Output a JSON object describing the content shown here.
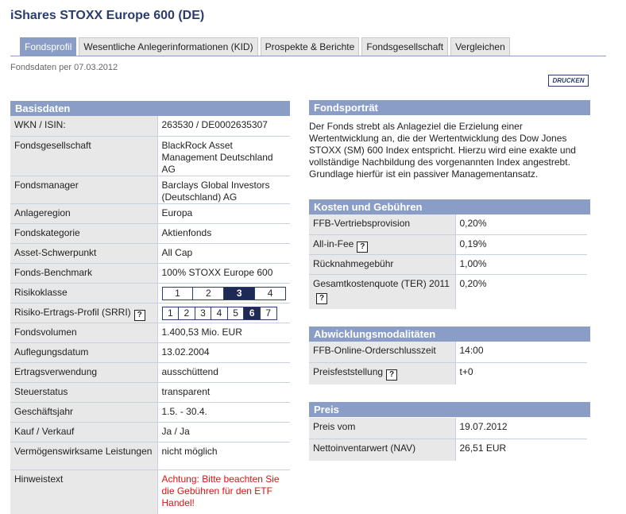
{
  "page": {
    "title": "iShares STOXX Europe 600 (DE)",
    "as_of": "Fondsdaten per 07.03.2012",
    "print_label": "DRUCKEN"
  },
  "tabs": [
    {
      "label": "Fondsprofil",
      "active": true
    },
    {
      "label": "Wesentliche Anlegerinformationen (KID)",
      "active": false
    },
    {
      "label": "Prospekte & Berichte",
      "active": false
    },
    {
      "label": "Fondsgesellschaft",
      "active": false
    },
    {
      "label": "Vergleichen",
      "active": false
    }
  ],
  "basisdaten": {
    "heading": "Basisdaten",
    "rows": [
      {
        "label": "WKN / ISIN:",
        "value": "263530 / DE0002635307"
      },
      {
        "label": "Fondsgesellschaft",
        "value": "BlackRock Asset Management Deutschland AG"
      },
      {
        "label": "Fondsmanager",
        "value": "Barclays Global Investors (Deutschland) AG"
      },
      {
        "label": "Anlageregion",
        "value": "Europa"
      },
      {
        "label": "Fondskategorie",
        "value": "Aktienfonds"
      },
      {
        "label": "Asset-Schwerpunkt",
        "value": "All Cap"
      },
      {
        "label": "Fonds-Benchmark",
        "value": "100% STOXX Europe 600"
      },
      {
        "label": "Risikoklasse",
        "scale": [
          "1",
          "2",
          "3",
          "4"
        ],
        "selected": "3"
      },
      {
        "label": "Risiko-Ertrags-Profil (SRRI)",
        "help": "?",
        "scale": [
          "1",
          "2",
          "3",
          "4",
          "5",
          "6",
          "7"
        ],
        "selected": "6"
      },
      {
        "label": "Fondsvolumen",
        "value": "1.400,53 Mio. EUR"
      },
      {
        "label": "Auflegungsdatum",
        "value": "13.02.2004"
      },
      {
        "label": "Ertragsverwendung",
        "value": "ausschüttend"
      },
      {
        "label": "Steuerstatus",
        "value": "transparent"
      },
      {
        "label": "Geschäftsjahr",
        "value": "1.5. - 30.4."
      },
      {
        "label": "Kauf / Verkauf",
        "value": "Ja / Ja"
      },
      {
        "label": "Vermögenswirksame Leistungen",
        "value": "nicht möglich"
      },
      {
        "label": "Hinweistext",
        "value": "Achtung: Bitte beachten Sie die Gebühren für den ETF Handel!",
        "warning": true
      }
    ]
  },
  "portrait": {
    "heading": "Fondsporträt",
    "text": "Der Fonds strebt als Anlageziel die Erzielung einer Wertentwicklung an, die der Wertentwicklung des Dow Jones STOXX (SM) 600 Index entspricht. Hierzu wird eine exakte und vollständige Nachbildung des vorgenannten Index angestrebt. Grundlage hierfür ist ein passiver Managementansatz."
  },
  "kosten": {
    "heading": "Kosten und Gebühren",
    "rows": [
      {
        "label": "FFB-Vertriebsprovision",
        "value": "0,20%"
      },
      {
        "label": "All-in-Fee",
        "help": "?",
        "value": "0,19%"
      },
      {
        "label": "Rücknahmegebühr",
        "value": "1,00%"
      },
      {
        "label": "Gesamtkostenquote (TER) 2011",
        "help": "?",
        "value": "0,20%"
      }
    ]
  },
  "abwicklung": {
    "heading": "Abwicklungsmodalitäten",
    "rows": [
      {
        "label": "FFB-Online-Orderschlusszeit",
        "value": "14:00"
      },
      {
        "label": "Preisfeststellung",
        "help": "?",
        "value": "t+0"
      }
    ]
  },
  "preis": {
    "heading": "Preis",
    "rows": [
      {
        "label": "Preis vom",
        "value": "19.07.2012"
      },
      {
        "label": "Nettoinventarwert (NAV)",
        "value": "26,51 EUR"
      }
    ]
  },
  "colors": {
    "accent": "#8a9dc6",
    "title": "#2b3d6e",
    "scale_selected": "#1e2a55",
    "warning": "#d81414"
  }
}
